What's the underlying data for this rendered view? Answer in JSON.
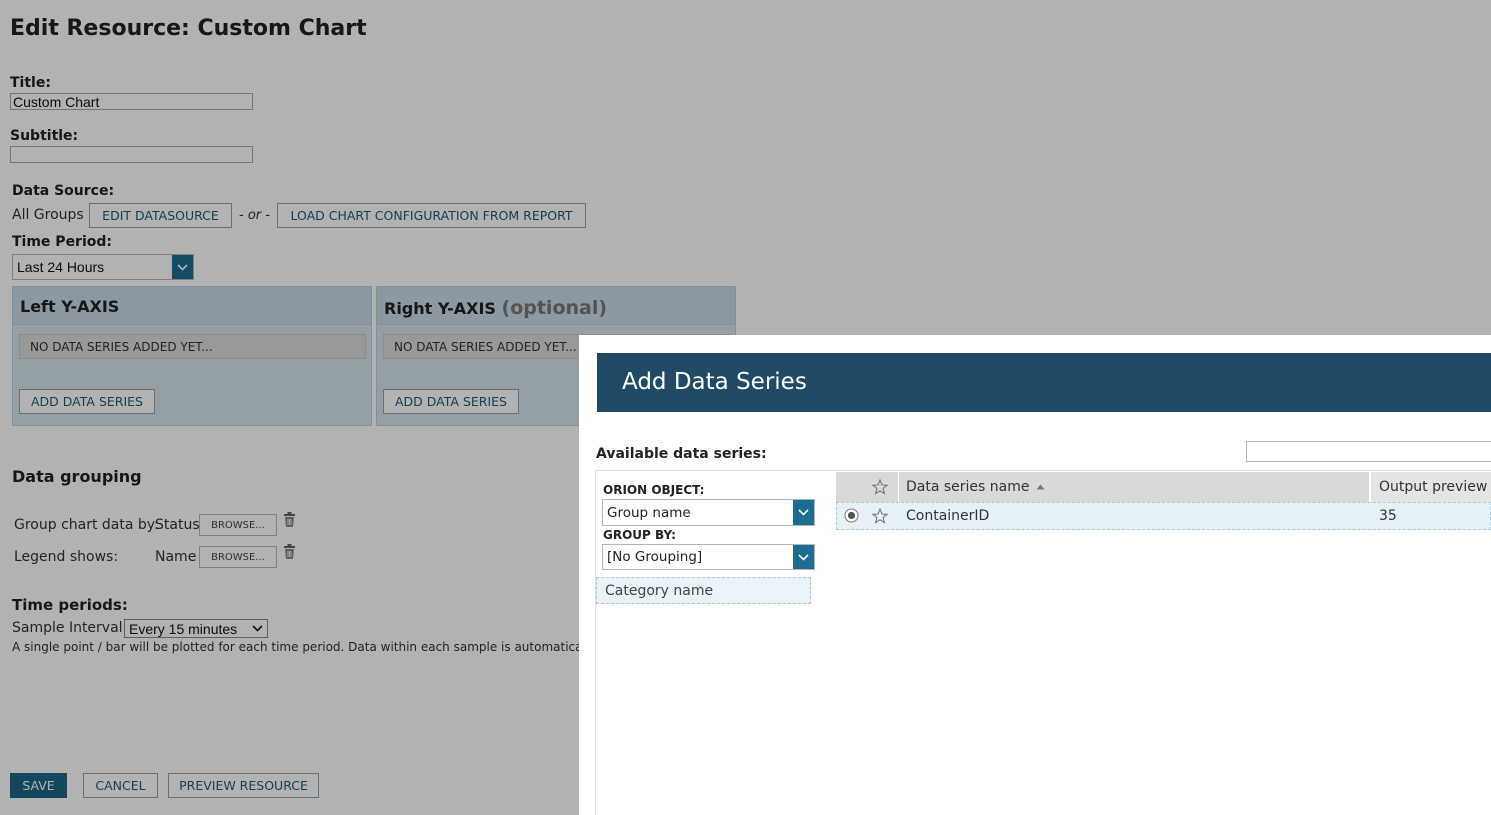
{
  "page": {
    "title": "Edit Resource: Custom Chart",
    "title_label": "Title:",
    "title_value": "Custom Chart",
    "subtitle_label": "Subtitle:",
    "subtitle_value": "",
    "datasource_label": "Data Source:",
    "datasource_value": "All Groups",
    "edit_datasource": "EDIT DATASOURCE",
    "or_text": "- or -",
    "load_config": "LOAD CHART CONFIGURATION FROM REPORT",
    "time_period_label": "Time Period:",
    "time_period_value": "Last 24 Hours",
    "left_axis": {
      "title": "Left Y-AXIS",
      "empty": "NO DATA SERIES ADDED YET...",
      "add": "ADD DATA SERIES"
    },
    "right_axis": {
      "title": "Right Y-AXIS",
      "optional": "(optional)",
      "empty": "NO DATA SERIES ADDED YET...",
      "add": "ADD DATA SERIES"
    },
    "grouping": {
      "heading": "Data grouping",
      "group_by_label": "Group chart data by:",
      "group_by_value": "Status",
      "legend_label": "Legend shows:",
      "legend_value": "Name",
      "browse": "BROWSE..."
    },
    "time_periods": {
      "heading": "Time periods:",
      "sample_label": "Sample Interval:",
      "sample_value": "Every 15 minutes",
      "note": "A single point / bar will be plotted for each time period. Data within each sample is automatically sum"
    },
    "footer": {
      "save": "SAVE",
      "cancel": "CANCEL",
      "preview": "PREVIEW RESOURCE"
    }
  },
  "dialog": {
    "title": "Add Data Series",
    "available_label": "Available data series:",
    "search_value": "",
    "orion_object_label": "ORION OBJECT:",
    "orion_object_value": "Group name",
    "group_by_label": "GROUP BY:",
    "group_by_value": "[No Grouping]",
    "category_item": "Category name",
    "table": {
      "headers": {
        "name": "Data series name",
        "preview": "Output preview"
      },
      "rows": [
        {
          "name": "ContainerID",
          "preview": "35"
        }
      ]
    }
  },
  "colors": {
    "accent": "#1b6686",
    "dialog_header": "#204a66",
    "panel": "#d5e5ee"
  }
}
